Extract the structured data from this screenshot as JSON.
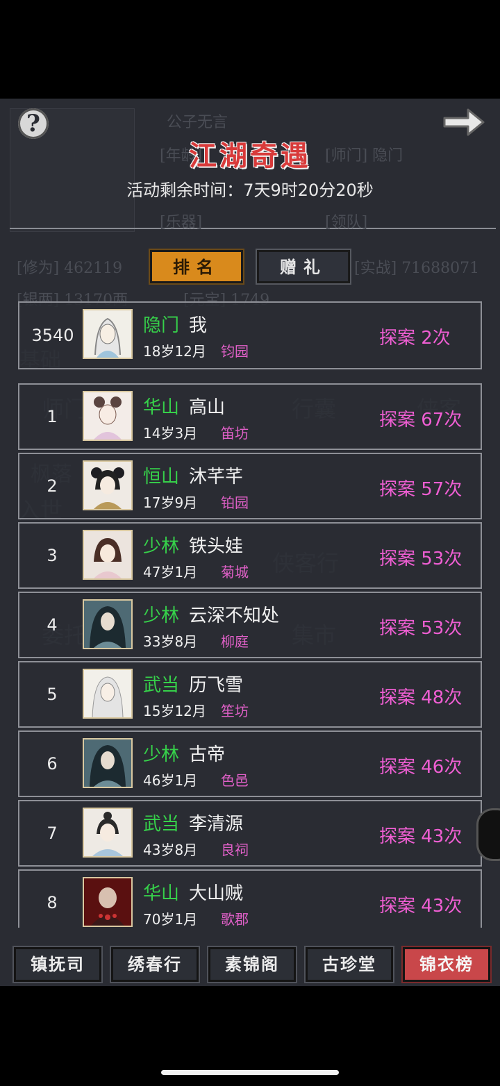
{
  "header": {
    "title": "江湖奇遇",
    "timer_label": "活动剩余时间：",
    "timer_value": "7天9时20分20秒"
  },
  "tabs": [
    {
      "label": "排名",
      "active": true
    },
    {
      "label": "赠礼",
      "active": false
    }
  ],
  "background_text": [
    "公子无言",
    "[年龄]",
    "[师门] 隐门",
    "[乐器]",
    "[领队]",
    "[修为] 462119",
    "[实战] 71688071",
    "[银两] 13170两",
    "[元宝] 1749",
    "基础",
    "师门",
    "行囊",
    "侠客",
    "枫落",
    "入世",
    "侠客行",
    "委托",
    "集市"
  ],
  "my_entry": {
    "rank": "3540",
    "sect": "隐门",
    "name": "我",
    "age": "18岁12月",
    "place": "钧园",
    "count": "探案 2次"
  },
  "leaderboard": [
    {
      "rank": "1",
      "sect": "华山",
      "name": "高山",
      "age": "14岁3月",
      "place": "笛坊",
      "count": "探案 67次"
    },
    {
      "rank": "2",
      "sect": "恒山",
      "name": "沐芊芊",
      "age": "17岁9月",
      "place": "铂园",
      "count": "探案 57次"
    },
    {
      "rank": "3",
      "sect": "少林",
      "name": "铁头娃",
      "age": "47岁1月",
      "place": "菊城",
      "count": "探案 53次"
    },
    {
      "rank": "4",
      "sect": "少林",
      "name": "云深不知处",
      "age": "33岁8月",
      "place": "柳庭",
      "count": "探案 53次"
    },
    {
      "rank": "5",
      "sect": "武当",
      "name": "历飞雪",
      "age": "15岁12月",
      "place": "笙坊",
      "count": "探案 48次"
    },
    {
      "rank": "6",
      "sect": "少林",
      "name": "古帝",
      "age": "46岁1月",
      "place": "色邑",
      "count": "探案 46次"
    },
    {
      "rank": "7",
      "sect": "武当",
      "name": "李清源",
      "age": "43岁8月",
      "place": "良祠",
      "count": "探案 43次"
    },
    {
      "rank": "8",
      "sect": "华山",
      "name": "大山贼",
      "age": "70岁1月",
      "place": "歌郡",
      "count": "探案 43次"
    }
  ],
  "bottom_nav": [
    {
      "label": "镇抚司",
      "active": false
    },
    {
      "label": "绣春行",
      "active": false
    },
    {
      "label": "素锦阁",
      "active": false
    },
    {
      "label": "古珍堂",
      "active": false
    },
    {
      "label": "锦衣榜",
      "active": true
    }
  ],
  "colors": {
    "sect": "#36d14a",
    "place": "#e060c8",
    "count": "#ee5ed2",
    "title": "#d83a3a",
    "tab_active": "#d98a1c",
    "nav_active": "#c9474a"
  }
}
